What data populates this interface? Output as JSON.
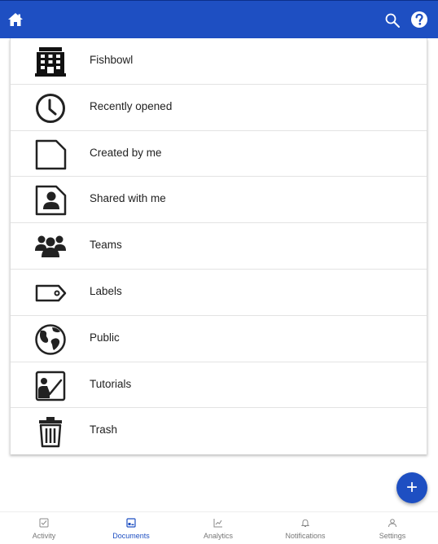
{
  "topbar": {
    "color": "#1e4fc2",
    "icons": [
      "home-icon",
      "search-icon",
      "help-icon"
    ]
  },
  "menu": {
    "items": [
      {
        "label": "Fishbowl",
        "icon": "building-icon"
      },
      {
        "label": "Recently opened",
        "icon": "clock-icon"
      },
      {
        "label": "Created by me",
        "icon": "document-icon"
      },
      {
        "label": "Shared with me",
        "icon": "shared-document-icon"
      },
      {
        "label": "Teams",
        "icon": "group-icon"
      },
      {
        "label": "Labels",
        "icon": "tag-icon"
      },
      {
        "label": "Public",
        "icon": "globe-icon"
      },
      {
        "label": "Tutorials",
        "icon": "tutorial-icon"
      },
      {
        "label": "Trash",
        "icon": "trash-icon"
      }
    ]
  },
  "fab": {
    "label": "+",
    "color": "#1e4fc2"
  },
  "bottom_nav": {
    "items": [
      {
        "label": "Activity",
        "icon": "activity-icon",
        "active": false
      },
      {
        "label": "Documents",
        "icon": "documents-icon",
        "active": true
      },
      {
        "label": "Analytics",
        "icon": "analytics-icon",
        "active": false
      },
      {
        "label": "Notifications",
        "icon": "bell-icon",
        "active": false
      },
      {
        "label": "Settings",
        "icon": "person-icon",
        "active": false
      }
    ],
    "active_color": "#1e4fc2"
  }
}
